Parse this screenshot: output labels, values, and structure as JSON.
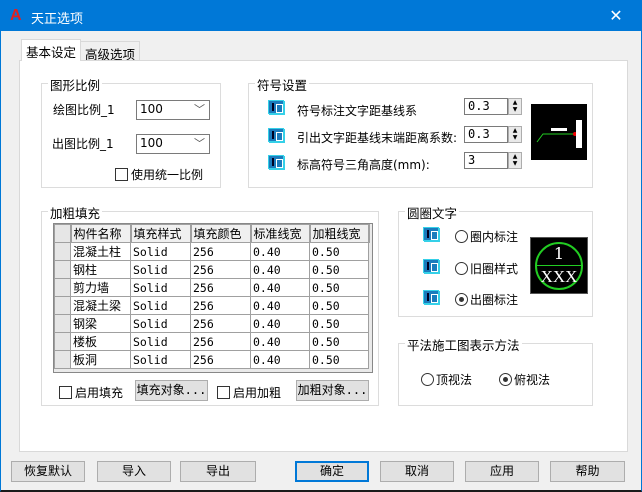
{
  "window": {
    "title": "天正选项",
    "close": "✕",
    "logo": "A"
  },
  "tabs": [
    {
      "label": "基本设定",
      "active": true
    },
    {
      "label": "高级选项",
      "active": false
    }
  ],
  "scale": {
    "title": "图形比例",
    "draw_label": "绘图比例_1",
    "draw_value": "100",
    "out_label": "出图比例_1",
    "out_value": "100",
    "unify_label": "使用统一比例",
    "unify_checked": false
  },
  "symbol": {
    "title": "符号设置",
    "rows": [
      {
        "label": "符号标注文字距基线系",
        "value": "0.3"
      },
      {
        "label": "引出文字距基线末端距离系数:",
        "value": "0.3"
      },
      {
        "label": "标高符号三角高度(mm):",
        "value": "3"
      }
    ]
  },
  "fill": {
    "title": "加粗填充",
    "columns": [
      "构件名称",
      "填充样式",
      "填充颜色",
      "标准线宽",
      "加粗线宽"
    ],
    "rows": [
      [
        "混凝土柱",
        "Solid",
        "256",
        "0.40",
        "0.50"
      ],
      [
        "钢柱",
        "Solid",
        "256",
        "0.40",
        "0.50"
      ],
      [
        "剪力墙",
        "Solid",
        "256",
        "0.40",
        "0.50"
      ],
      [
        "混凝土梁",
        "Solid",
        "256",
        "0.40",
        "0.50"
      ],
      [
        "钢梁",
        "Solid",
        "256",
        "0.40",
        "0.50"
      ],
      [
        "楼板",
        "Solid",
        "256",
        "0.40",
        "0.50"
      ],
      [
        "板洞",
        "Solid",
        "256",
        "0.40",
        "0.50"
      ]
    ],
    "enable_fill": "启用填充",
    "fill_objects": "填充对象...",
    "enable_bold": "启用加粗",
    "bold_objects": "加粗对象..."
  },
  "circle": {
    "title": "圆圈文字",
    "options": [
      {
        "label": "圈内标注",
        "selected": false
      },
      {
        "label": "旧圈样式",
        "selected": false
      },
      {
        "label": "出圈标注",
        "selected": true
      }
    ],
    "preview_top": "1",
    "preview_bottom": "XXX"
  },
  "method": {
    "title": "平法施工图表示方法",
    "options": [
      {
        "label": "顶视法",
        "selected": false
      },
      {
        "label": "俯视法",
        "selected": true
      }
    ]
  },
  "buttons": {
    "reset": "恢复默认",
    "import": "导入",
    "export": "导出",
    "ok": "确定",
    "cancel": "取消",
    "apply": "应用",
    "help": "帮助"
  },
  "colors": {
    "titlebar": "#0078d7",
    "preview_green": "#22cc22"
  }
}
